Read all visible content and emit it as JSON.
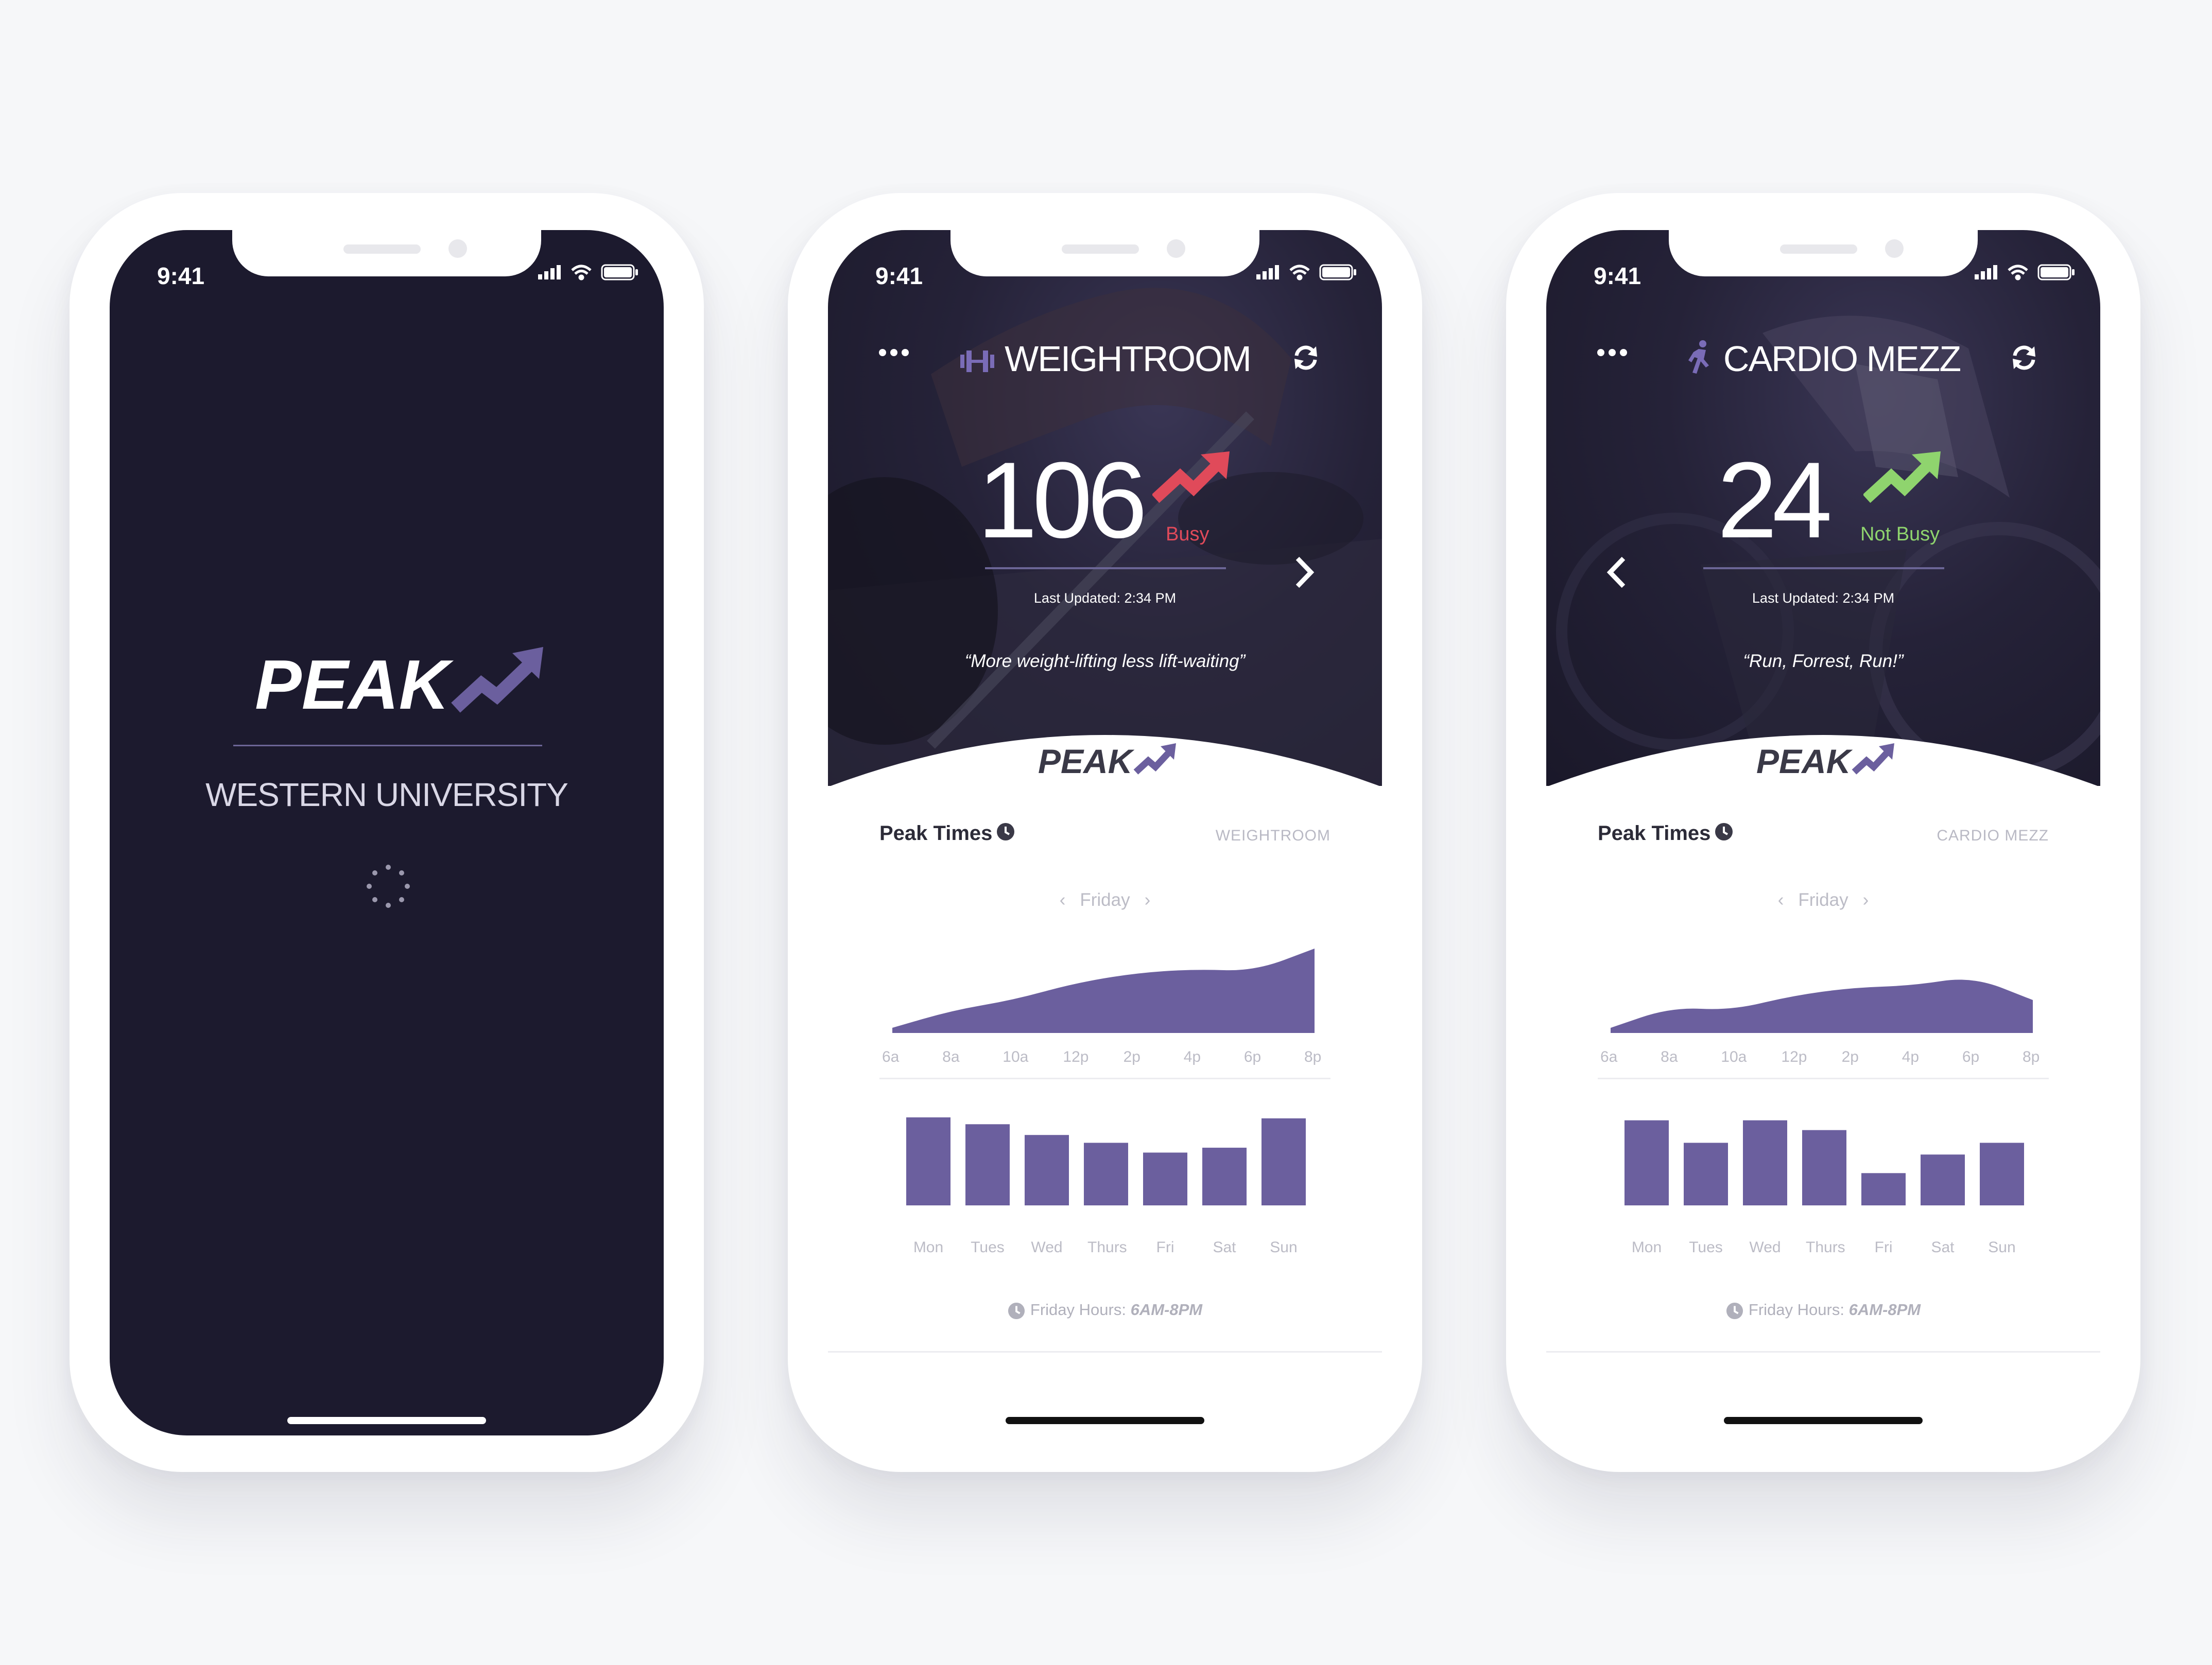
{
  "status_time": "9:41",
  "brand": {
    "logo": "PEAK",
    "accent": "#6b5f9e"
  },
  "splash": {
    "university": "WESTERN UNIVERSITY"
  },
  "axis_hours": [
    "6a",
    "8a",
    "10a",
    "12p",
    "2p",
    "4p",
    "6p",
    "8p"
  ],
  "weekdays": [
    "Mon",
    "Tues",
    "Wed",
    "Thurs",
    "Fri",
    "Sat",
    "Sun"
  ],
  "weightroom": {
    "venue": "WEIGHTROOM",
    "icon": "dumbbell-icon",
    "count": "106",
    "status": "Busy",
    "status_color": "#e04a5a",
    "updated": "Last Updated: 2:34 PM",
    "quote": "“More weight-lifting less lift-waiting”",
    "peak_title": "Peak Times",
    "peak_venue": "WEIGHTROOM",
    "day": "Friday",
    "hours_label": "Friday Hours: ",
    "hours_value": "6AM-8PM"
  },
  "cardio": {
    "venue": "CARDIO MEZZ",
    "icon": "runner-icon",
    "count": "24",
    "status": "Not Busy",
    "status_color": "#8fd46e",
    "updated": "Last Updated: 2:34 PM",
    "quote": "“Run, Forrest, Run!”",
    "peak_title": "Peak Times",
    "peak_venue": "CARDIO MEZZ",
    "day": "Friday",
    "hours_label": "Friday Hours: ",
    "hours_value": "6AM-8PM"
  },
  "chart_data": [
    {
      "type": "area",
      "name": "weightroom-hourly",
      "x": [
        "6a",
        "8a",
        "10a",
        "12p",
        "2p",
        "4p",
        "6p",
        "8p"
      ],
      "values": [
        5,
        22,
        32,
        48,
        58,
        62,
        60,
        82
      ],
      "ylim": [
        0,
        100
      ]
    },
    {
      "type": "bar",
      "name": "weightroom-weekly",
      "categories": [
        "Mon",
        "Tues",
        "Wed",
        "Thurs",
        "Fri",
        "Sat",
        "Sun"
      ],
      "values": [
        90,
        83,
        72,
        64,
        54,
        59,
        89
      ],
      "ylim": [
        0,
        100
      ]
    },
    {
      "type": "area",
      "name": "cardio-hourly",
      "x": [
        "6a",
        "8a",
        "10a",
        "12p",
        "2p",
        "4p",
        "6p",
        "8p"
      ],
      "values": [
        5,
        25,
        22,
        36,
        44,
        46,
        55,
        32
      ],
      "ylim": [
        0,
        100
      ]
    },
    {
      "type": "bar",
      "name": "cardio-weekly",
      "categories": [
        "Mon",
        "Tues",
        "Wed",
        "Thurs",
        "Fri",
        "Sat",
        "Sun"
      ],
      "values": [
        87,
        64,
        87,
        77,
        33,
        52,
        64
      ],
      "ylim": [
        0,
        100
      ]
    }
  ]
}
